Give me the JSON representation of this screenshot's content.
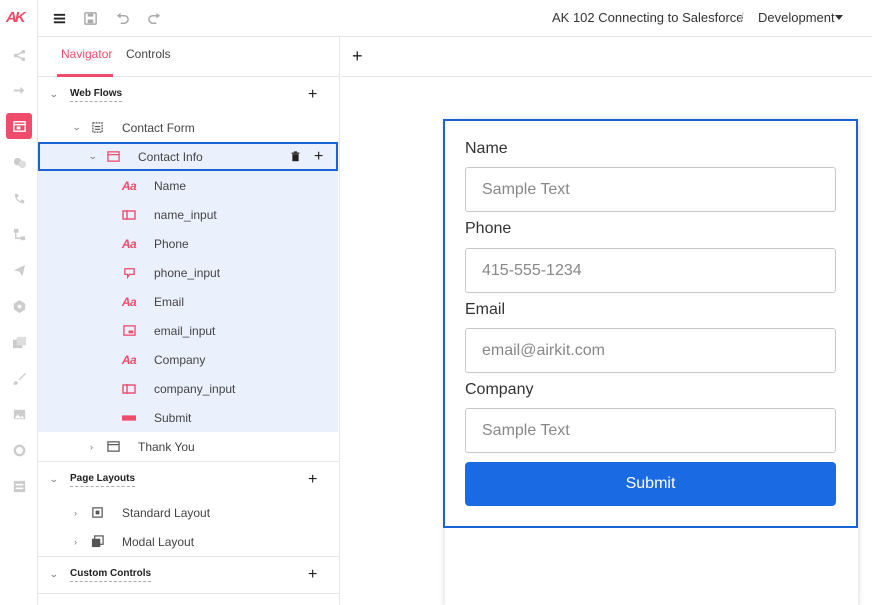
{
  "brand": {
    "logo_text": "AK",
    "accent": "#ef4b6a",
    "primary": "#1a6ae3"
  },
  "rail": {
    "items": [
      {
        "icon": "connections-icon"
      },
      {
        "icon": "flow-icon"
      },
      {
        "icon": "web-flows-icon",
        "active": true
      },
      {
        "icon": "chat-icon"
      },
      {
        "icon": "voice-icon"
      },
      {
        "icon": "data-flows-icon"
      },
      {
        "icon": "send-icon"
      },
      {
        "icon": "apps-icon"
      },
      {
        "icon": "media-icon"
      },
      {
        "icon": "theme-brush-icon"
      },
      {
        "icon": "image-icon"
      },
      {
        "icon": "sync-icon"
      },
      {
        "icon": "settings-panel-icon"
      }
    ]
  },
  "topbar": {
    "project": "AK 102 Connecting to Salesforce",
    "separator": "/",
    "environment": "Development"
  },
  "navigator": {
    "tabs": [
      "Navigator",
      "Controls"
    ],
    "active_tab": "Navigator",
    "sections": {
      "web_flows": "Web Flows",
      "page_layouts": "Page Layouts",
      "custom_controls": "Custom Controls"
    },
    "tree": {
      "contact_form": "Contact Form",
      "contact_info": "Contact Info",
      "children": [
        {
          "label": "Name",
          "icon": "label-icon"
        },
        {
          "label": "name_input",
          "icon": "text-input-icon"
        },
        {
          "label": "Phone",
          "icon": "label-icon"
        },
        {
          "label": "phone_input",
          "icon": "phone-input-icon"
        },
        {
          "label": "Email",
          "icon": "label-icon"
        },
        {
          "label": "email_input",
          "icon": "email-input-icon"
        },
        {
          "label": "Company",
          "icon": "label-icon"
        },
        {
          "label": "company_input",
          "icon": "text-input-icon"
        },
        {
          "label": "Submit",
          "icon": "button-icon"
        }
      ],
      "thank_you": "Thank You",
      "standard_layout": "Standard Layout",
      "modal_layout": "Modal Layout"
    },
    "label_glyph": "Aa"
  },
  "canvas": {
    "add": "+",
    "form": {
      "fields": [
        {
          "label": "Name",
          "placeholder": "Sample Text"
        },
        {
          "label": "Phone",
          "placeholder": "415-555-1234"
        },
        {
          "label": "Email",
          "placeholder": "email@airkit.com"
        },
        {
          "label": "Company",
          "placeholder": "Sample Text"
        }
      ],
      "submit": "Submit"
    }
  }
}
